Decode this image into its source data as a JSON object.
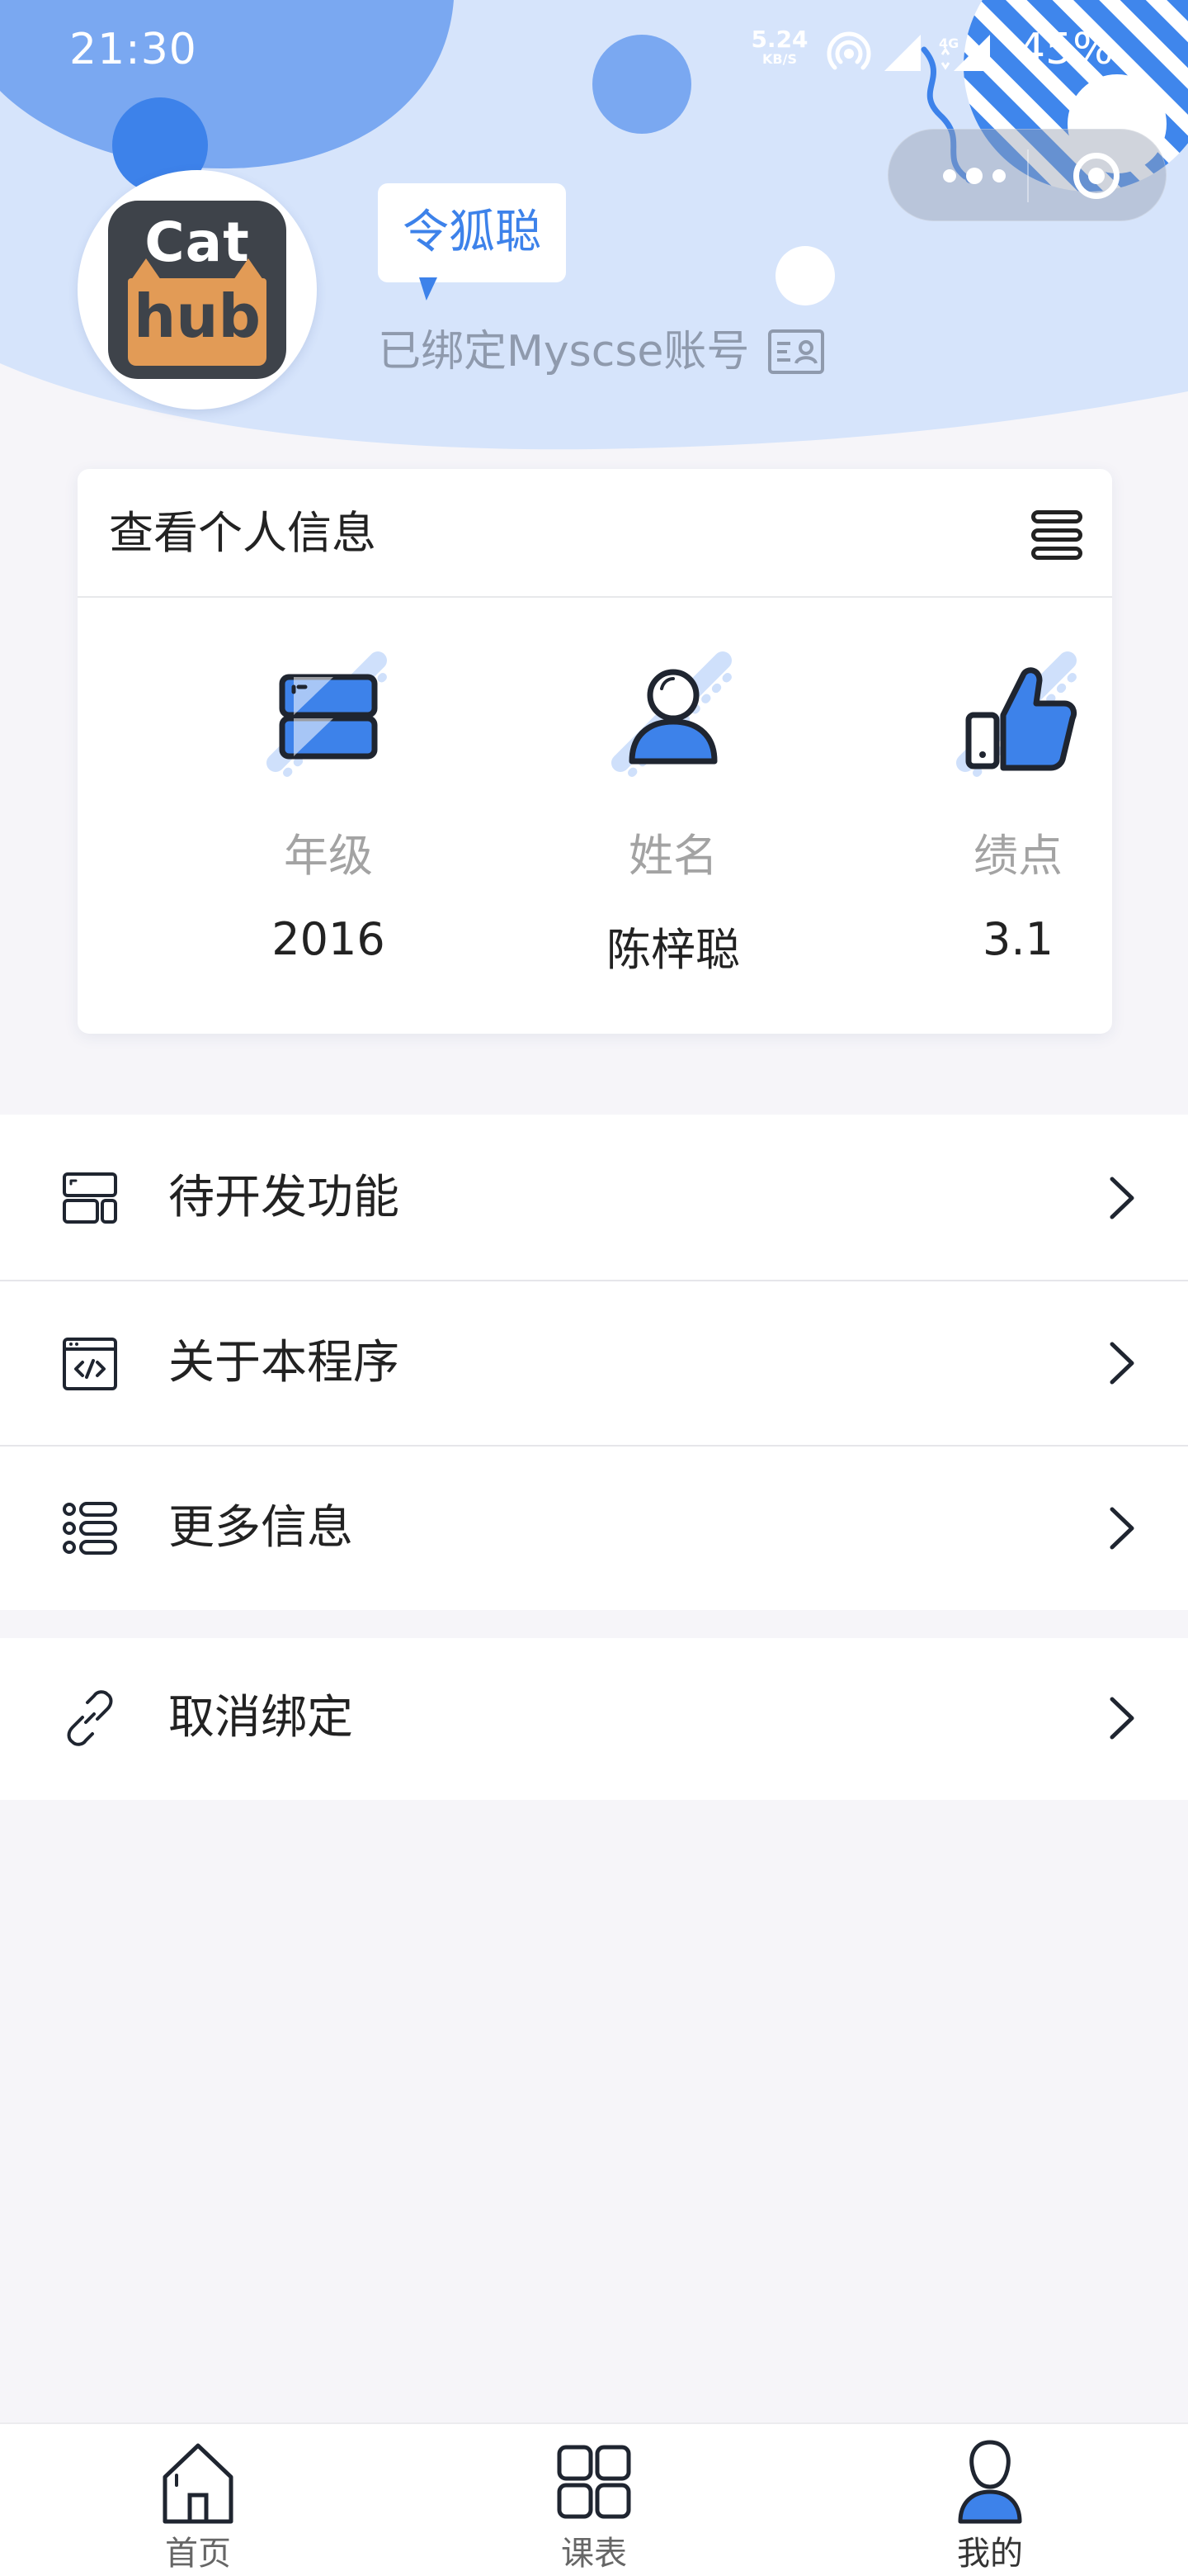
{
  "status_bar": {
    "time": "21:30",
    "net_speed_value": "5.24",
    "net_speed_unit": "KB/S",
    "battery": "45%"
  },
  "capsule": {
    "more_icon": "more-dots-icon",
    "close_icon": "target-close-icon"
  },
  "profile": {
    "avatar_text_top": "Cat",
    "avatar_text_bottom": "hub",
    "nickname": "令狐聪",
    "bound_status": "已绑定Myscse账号",
    "bound_icon": "id-card-icon"
  },
  "info_card": {
    "title": "查看个人信息",
    "menu_icon": "stack-menu-icon",
    "stats": [
      {
        "icon": "grade-server-icon",
        "label": "年级",
        "value": "2016"
      },
      {
        "icon": "person-icon",
        "label": "姓名",
        "value": "陈梓聪"
      },
      {
        "icon": "thumbs-up-icon",
        "label": "绩点",
        "value": "3.1"
      }
    ]
  },
  "menu": {
    "group1": [
      {
        "icon": "layout-icon",
        "label": "待开发功能"
      },
      {
        "icon": "code-window-icon",
        "label": "关于本程序"
      },
      {
        "icon": "list-icon",
        "label": "更多信息"
      }
    ],
    "group2": [
      {
        "icon": "link-icon",
        "label": "取消绑定"
      }
    ]
  },
  "tabbar": {
    "tabs": [
      {
        "icon": "home-icon",
        "label": "首页"
      },
      {
        "icon": "grid-icon",
        "label": "课表"
      },
      {
        "icon": "user-icon",
        "label": "我的"
      }
    ],
    "active_index": 2
  },
  "colors": {
    "accent": "#3d82ea",
    "header_bg": "#d6e4fb",
    "page_bg": "#f6f5f9"
  }
}
